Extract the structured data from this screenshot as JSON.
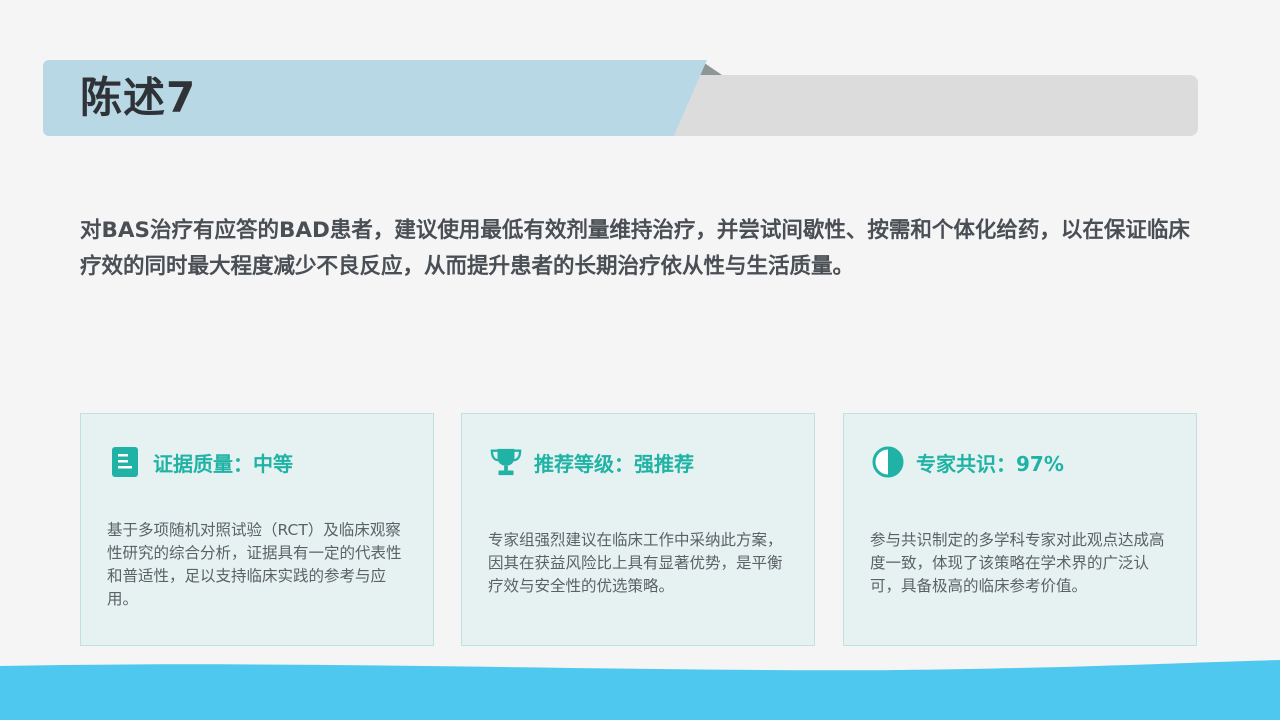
{
  "title": "陈述7",
  "statement": "对BAS治疗有应答的BAD患者，建议使用最低有效剂量维持治疗，并尝试间歇性、按需和个体化给药，以在保证临床疗效的同时最大程度减少不良反应，从而提升患者的长期治疗依从性与生活质量。",
  "cards": [
    {
      "icon": "document-icon",
      "title": "证据质量：中等",
      "body": "基于多项随机对照试验（RCT）及临床观察性研究的综合分析，证据具有一定的代表性和普适性，足以支持临床实践的参考与应用。"
    },
    {
      "icon": "trophy-icon",
      "title": "推荐等级：强推荐",
      "body": "专家组强烈建议在临床工作中采纳此方案，因其在获益风险比上具有显著优势，是平衡疗效与安全性的优选策略。"
    },
    {
      "icon": "half-circle-icon",
      "title": "专家共识：97%",
      "body": "参与共识制定的多学科专家对此观点达成高度一致，体现了该策略在学术界的广泛认可，具备极高的临床参考价值。"
    }
  ],
  "colors": {
    "accent": "#20b3a5",
    "title_band": "#b8d8e6",
    "card_bg": "#e5f2f1",
    "wave": "#4fc8ef"
  }
}
